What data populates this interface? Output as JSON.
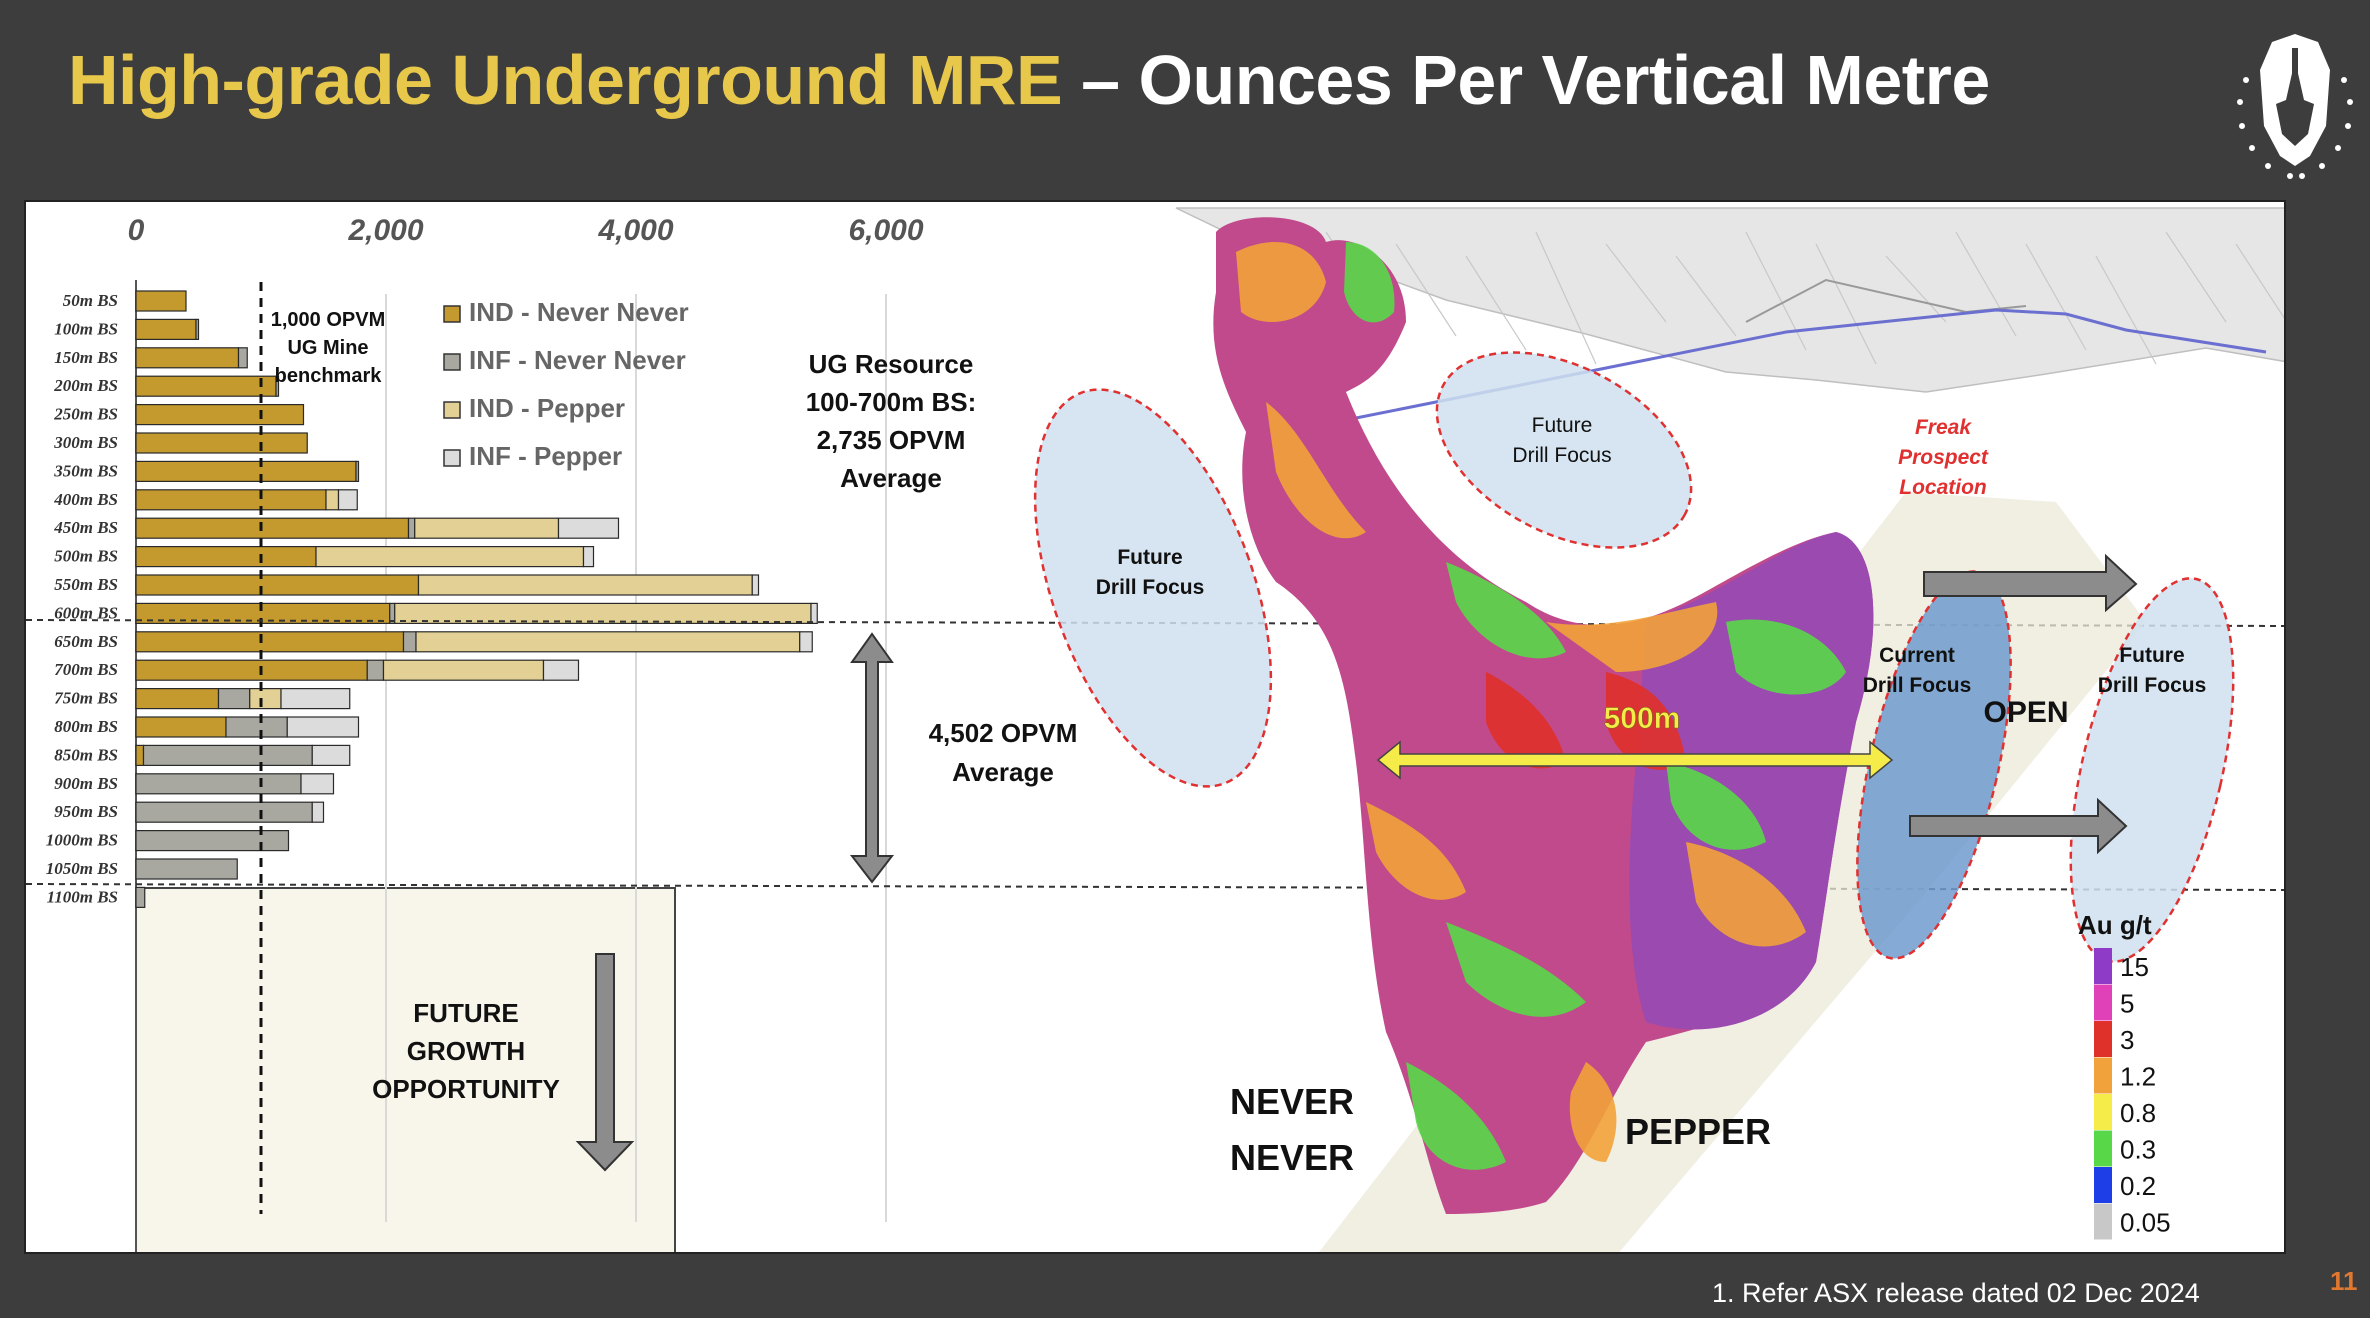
{
  "slide": {
    "title_highlight": "High-grade Underground MRE",
    "title_rest": " – Ounces Per Vertical Metre",
    "footnote": "1. Refer ASX release dated 02 Dec 2024",
    "page_number": "11"
  },
  "chart_data": {
    "type": "bar",
    "orientation": "horizontal",
    "stacked": true,
    "categories": [
      "50m BS",
      "100m BS",
      "150m BS",
      "200m BS",
      "250m BS",
      "300m BS",
      "350m BS",
      "400m BS",
      "450m BS",
      "500m BS",
      "550m BS",
      "600m BS",
      "650m BS",
      "700m BS",
      "750m BS",
      "800m BS",
      "850m BS",
      "900m BS",
      "950m BS",
      "1000m BS",
      "1050m BS",
      "1100m BS"
    ],
    "series": [
      {
        "name": "IND - Never Never",
        "color": "#c49a2e",
        "values": [
          400,
          480,
          820,
          1120,
          1340,
          1370,
          1760,
          1520,
          2180,
          1440,
          2260,
          2030,
          2140,
          1850,
          660,
          720,
          60,
          0,
          0,
          0,
          0,
          0
        ]
      },
      {
        "name": "INF - Never Never",
        "color": "#a8a8a0",
        "values": [
          0,
          20,
          70,
          20,
          0,
          0,
          20,
          0,
          50,
          0,
          0,
          40,
          100,
          130,
          250,
          490,
          1350,
          1320,
          1410,
          1220,
          810,
          70
        ]
      },
      {
        "name": "IND - Pepper",
        "color": "#e3d095",
        "values": [
          0,
          0,
          0,
          0,
          0,
          0,
          0,
          100,
          1150,
          2140,
          2670,
          3330,
          3070,
          1280,
          250,
          0,
          0,
          0,
          0,
          0,
          0,
          0
        ]
      },
      {
        "name": "INF - Pepper",
        "color": "#dcdcdc",
        "values": [
          0,
          0,
          0,
          0,
          0,
          0,
          0,
          150,
          480,
          80,
          50,
          50,
          100,
          280,
          550,
          570,
          300,
          260,
          90,
          0,
          0,
          0
        ]
      }
    ],
    "x_ticks": [
      "0",
      "2,000",
      "4,000",
      "6,000"
    ],
    "xlim": [
      0,
      6000
    ],
    "grid": true,
    "legend_position": "top-center",
    "benchmark": {
      "value": 1000,
      "label_lines": [
        "1,000 OPVM",
        "UG Mine",
        "benchmark"
      ]
    },
    "annotations": {
      "ug_resource": [
        "UG Resource",
        "100-700m BS:",
        "2,735 OPVM",
        "Average"
      ],
      "opvm_average": [
        "4,502 OPVM",
        "Average"
      ],
      "future_growth": [
        "FUTURE",
        "GROWTH",
        "OPPORTUNITY"
      ]
    }
  },
  "section": {
    "drill_focus_top": [
      "Future",
      "Drill Focus"
    ],
    "drill_focus_left": [
      "Future",
      "Drill Focus"
    ],
    "drill_focus_current": [
      "Current",
      "Drill Focus"
    ],
    "drill_focus_right": [
      "Future",
      "Drill Focus"
    ],
    "freak": [
      "Freak",
      "Prospect",
      "Location"
    ],
    "open_label": "OPEN",
    "scale_label": "500m",
    "never_never": [
      "NEVER",
      "NEVER"
    ],
    "pepper": "PEPPER",
    "grade_legend": {
      "title": "Au g/t",
      "items": [
        {
          "label": "15",
          "color": "#8e3bc7"
        },
        {
          "label": "5",
          "color": "#e040b8"
        },
        {
          "label": "3",
          "color": "#e0302a"
        },
        {
          "label": "1.2",
          "color": "#f2a23a"
        },
        {
          "label": "0.8",
          "color": "#f5ec4a"
        },
        {
          "label": "0.3",
          "color": "#58d848"
        },
        {
          "label": "0.2",
          "color": "#1e3ee8"
        },
        {
          "label": "0.05",
          "color": "#c8c8c8"
        }
      ]
    }
  }
}
